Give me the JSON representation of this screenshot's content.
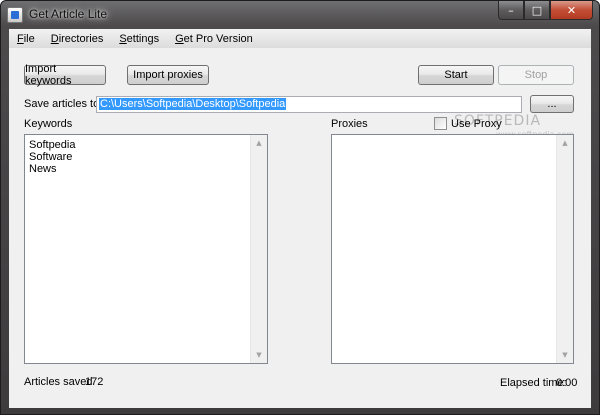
{
  "window": {
    "title": "Get Article Lite",
    "controls": {
      "minimize": "–",
      "maximize": "□",
      "close": "✕"
    }
  },
  "menu": [
    {
      "label": "File",
      "accel": "F",
      "rest": "ile"
    },
    {
      "label": "Directories",
      "accel": "D",
      "rest": "irectories"
    },
    {
      "label": "Settings",
      "accel": "S",
      "rest": "ettings"
    },
    {
      "label": "Get Pro Version",
      "accel": "G",
      "rest": "et Pro Version"
    }
  ],
  "toolbar": {
    "import_keywords": "Import keywords",
    "import_proxies": "Import proxies",
    "start": "Start",
    "stop": "Stop"
  },
  "save": {
    "label": "Save articles to",
    "path": "C:\\Users\\Softpedia\\Desktop\\Softpedia",
    "browse": "..."
  },
  "keywords": {
    "label": "Keywords",
    "items": [
      "Softpedia",
      "Software",
      "News"
    ]
  },
  "proxies": {
    "label": "Proxies",
    "use_proxy_label": "Use Proxy",
    "use_proxy_checked": false,
    "items": []
  },
  "status": {
    "articles_saved_label": "Articles saved",
    "articles_saved_value": "172",
    "elapsed_label": "Elapsed time:",
    "elapsed_value": "0:00"
  },
  "watermark": {
    "main": "SOFTPEDIA",
    "sub": "www.softpedia.com"
  },
  "colors": {
    "selection": "#3399ff",
    "close_button": "#c24e35",
    "client_bg": "#f0f0f0"
  }
}
